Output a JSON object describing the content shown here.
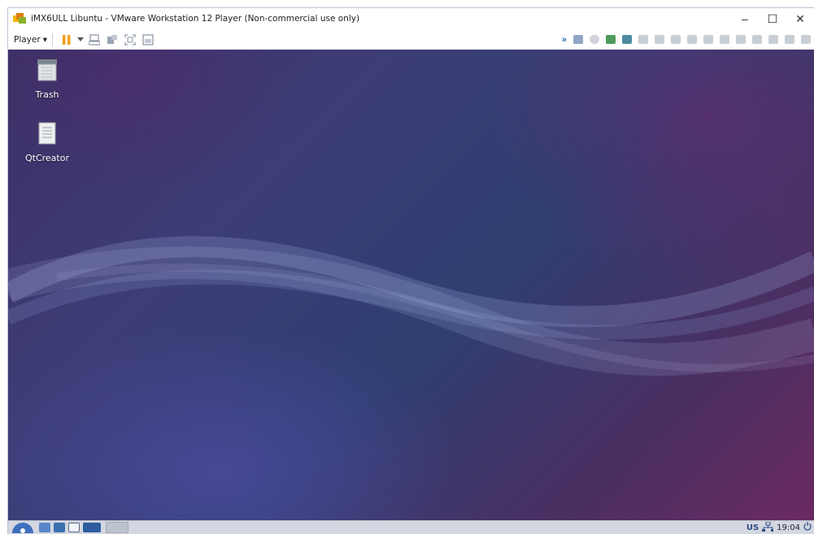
{
  "window": {
    "title": "iMX6ULL Libuntu - VMware Workstation 12 Player (Non-commercial use only)",
    "minimize_label": "–",
    "maximize_label": "☐",
    "close_label": "✕"
  },
  "toolbar": {
    "player_menu_label": "Player",
    "player_menu_arrow": "▾"
  },
  "desktop": {
    "icons": [
      {
        "label": "Trash",
        "icon": "trash-icon"
      },
      {
        "label": "QtCreator",
        "icon": "document-icon"
      }
    ]
  },
  "taskbar": {
    "keyboard_layout": "US",
    "clock": "19:04"
  },
  "colors": {
    "desktop_dark": "#3d3d77",
    "desktop_magenta": "#6b2a62",
    "taskbar_bg": "#d3d7df",
    "pause_orange": "#f0a020"
  }
}
